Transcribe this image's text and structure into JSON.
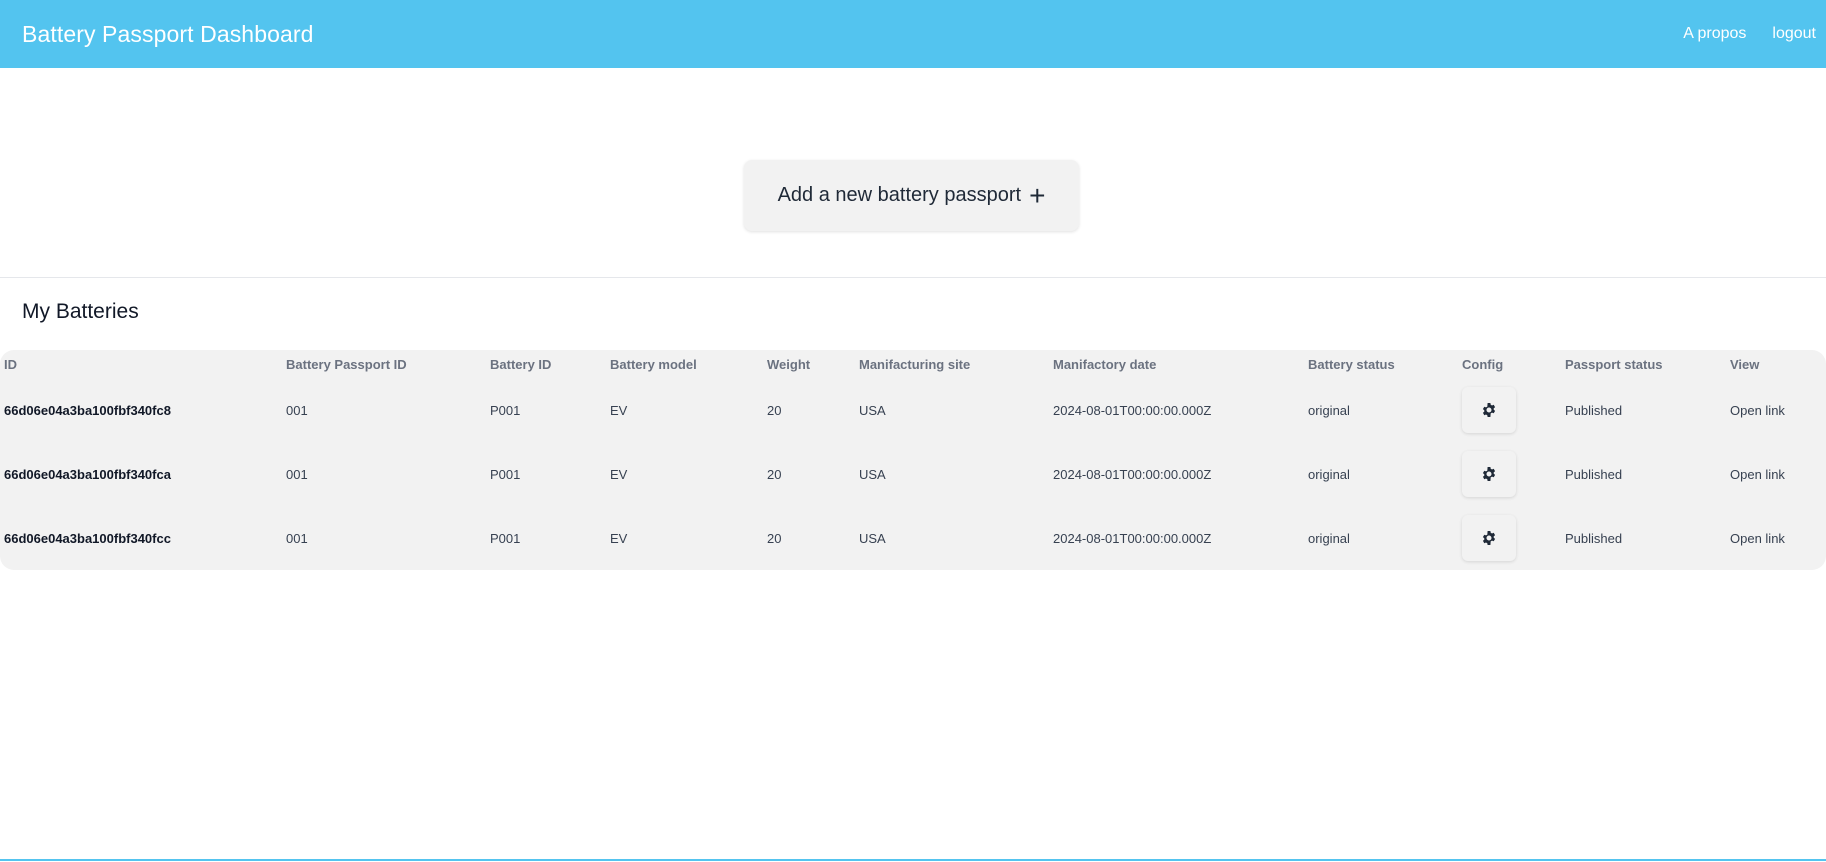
{
  "header": {
    "title": "Battery Passport Dashboard",
    "nav": [
      "A propos",
      "logout"
    ]
  },
  "actions": {
    "add_label": "Add a new battery passport"
  },
  "section": {
    "title": "My Batteries"
  },
  "table": {
    "columns": [
      "ID",
      "Battery Passport ID",
      "Battery ID",
      "Battery model",
      "Weight",
      "Manifacturing site",
      "Manifactory date",
      "Battery status",
      "Config",
      "Passport status",
      "View"
    ],
    "rows": [
      [
        "66d06e04a3ba100fbf340fc8",
        "001",
        "P001",
        "EV",
        "20",
        "USA",
        "2024-08-01T00:00:00.000Z",
        "original",
        "",
        "Published",
        "Open link"
      ],
      [
        "66d06e04a3ba100fbf340fca",
        "001",
        "P001",
        "EV",
        "20",
        "USA",
        "2024-08-01T00:00:00.000Z",
        "original",
        "",
        "Published",
        "Open link"
      ],
      [
        "66d06e04a3ba100fbf340fcc",
        "001",
        "P001",
        "EV",
        "20",
        "USA",
        "2024-08-01T00:00:00.000Z",
        "original",
        "",
        "Published",
        "Open link"
      ]
    ]
  },
  "colors": {
    "header_bg": "#53c4ef",
    "table_bg": "#f2f2f2"
  }
}
